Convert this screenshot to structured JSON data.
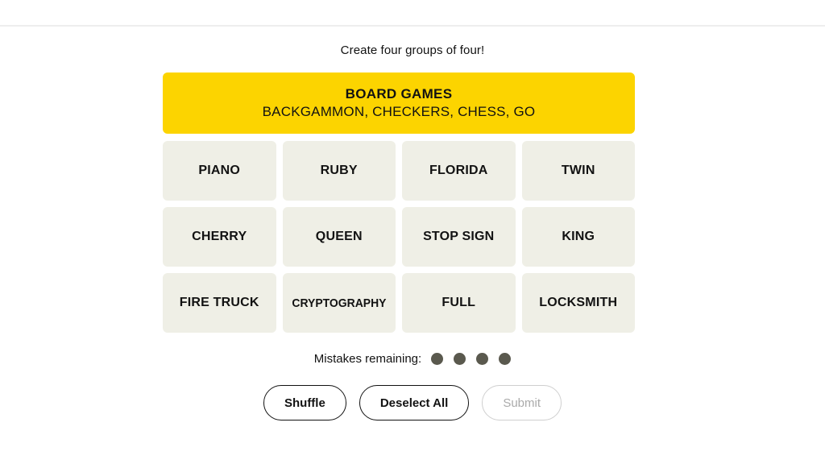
{
  "page": {
    "subtitle": "Create four groups of four!",
    "background_color": "#ffffff",
    "divider_color": "#eeeeee"
  },
  "solved_groups": [
    {
      "title": "BOARD GAMES",
      "members": "BACKGAMMON, CHECKERS, CHESS, GO",
      "color": "#fcd400",
      "difficulty": "yellow"
    }
  ],
  "grid": {
    "tile_color": "#efefe6",
    "rows": [
      [
        "PIANO",
        "RUBY",
        "FLORIDA",
        "TWIN"
      ],
      [
        "CHERRY",
        "QUEEN",
        "STOP SIGN",
        "KING"
      ],
      [
        "FIRE TRUCK",
        "CRYPTOGRAPHY",
        "FULL",
        "LOCKSMITH"
      ]
    ],
    "tiles": [
      "PIANO",
      "RUBY",
      "FLORIDA",
      "TWIN",
      "CHERRY",
      "QUEEN",
      "STOP SIGN",
      "KING",
      "FIRE TRUCK",
      "CRYPTOGRAPHY",
      "FULL",
      "LOCKSMITH"
    ]
  },
  "mistakes": {
    "label": "Mistakes remaining:",
    "remaining": 4,
    "dot_color": "#5a594e"
  },
  "actions": {
    "shuffle_label": "Shuffle",
    "deselect_label": "Deselect All",
    "submit_label": "Submit",
    "submit_enabled": false
  }
}
